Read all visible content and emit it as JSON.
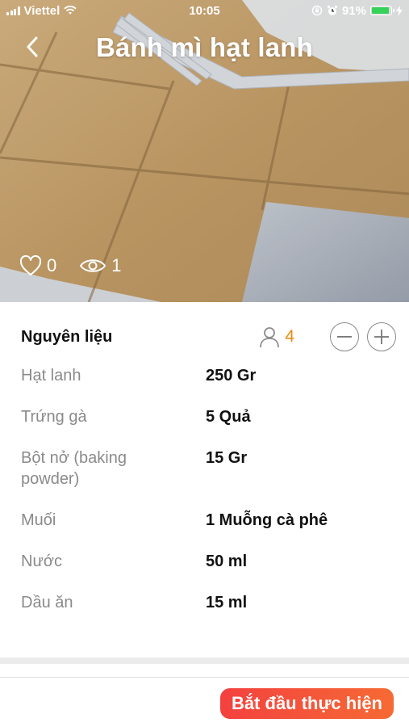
{
  "status_bar": {
    "carrier": "Viettel",
    "time": "10:05",
    "battery_percent": "91%",
    "battery_level": 0.91
  },
  "header": {
    "title": "Bánh mì hạt lanh",
    "back_icon": "chevron-left-icon"
  },
  "stats": {
    "likes": "0",
    "views": "1"
  },
  "ingredients": {
    "heading": "Nguyên liệu",
    "servings": "4",
    "items": [
      {
        "name": "Hạt lanh",
        "qty": "250 Gr"
      },
      {
        "name": "Trứng gà",
        "qty": "5 Quả"
      },
      {
        "name": "Bột nở (baking powder)",
        "qty": "15 Gr"
      },
      {
        "name": "Muối",
        "qty": "1 Muỗng cà phê"
      },
      {
        "name": "Nước",
        "qty": "50 ml"
      },
      {
        "name": "Dầu ăn",
        "qty": "15 ml"
      }
    ]
  },
  "footer": {
    "start_label": "Bắt đầu thực hiện"
  },
  "colors": {
    "accent_orange": "#f0870f",
    "button_start": "#f3413f",
    "button_end": "#f66a34"
  }
}
